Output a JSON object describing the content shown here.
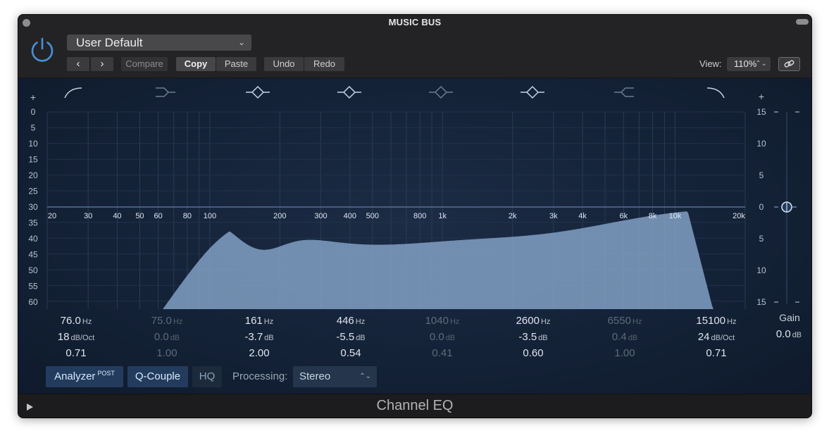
{
  "window": {
    "title": "MUSIC BUS",
    "plugin_name": "Channel EQ"
  },
  "header": {
    "preset": "User Default",
    "prev_label": "‹",
    "next_label": "›",
    "compare_label": "Compare",
    "copy_label": "Copy",
    "paste_label": "Paste",
    "undo_label": "Undo",
    "redo_label": "Redo",
    "view_label": "View:",
    "view_value": "110%"
  },
  "graph": {
    "db_left_labels": [
      "0",
      "5",
      "10",
      "15",
      "20",
      "25",
      "30",
      "35",
      "40",
      "45",
      "50",
      "55",
      "60"
    ],
    "db_right_labels": [
      "15",
      "10",
      "5",
      "0",
      "5",
      "10",
      "15"
    ],
    "freq_labels": [
      "20",
      "30",
      "40",
      "50",
      "60",
      "80",
      "100",
      "200",
      "300",
      "400",
      "500",
      "800",
      "1k",
      "2k",
      "3k",
      "4k",
      "6k",
      "8k",
      "10k",
      "20k"
    ]
  },
  "bands": [
    {
      "freq": "76.0",
      "freq_unit": "Hz",
      "gain": "18",
      "gain_unit": "dB/Oct",
      "q": "0.71",
      "active": true,
      "type": "low-cut"
    },
    {
      "freq": "75.0",
      "freq_unit": "Hz",
      "gain": "0.0",
      "gain_unit": "dB",
      "q": "1.00",
      "active": false,
      "type": "low-shelf"
    },
    {
      "freq": "161",
      "freq_unit": "Hz",
      "gain": "-3.7",
      "gain_unit": "dB",
      "q": "2.00",
      "active": true,
      "type": "bell"
    },
    {
      "freq": "446",
      "freq_unit": "Hz",
      "gain": "-5.5",
      "gain_unit": "dB",
      "q": "0.54",
      "active": true,
      "type": "bell"
    },
    {
      "freq": "1040",
      "freq_unit": "Hz",
      "gain": "0.0",
      "gain_unit": "dB",
      "q": "0.41",
      "active": false,
      "type": "bell"
    },
    {
      "freq": "2600",
      "freq_unit": "Hz",
      "gain": "-3.5",
      "gain_unit": "dB",
      "q": "0.60",
      "active": true,
      "type": "bell"
    },
    {
      "freq": "6550",
      "freq_unit": "Hz",
      "gain": "0.4",
      "gain_unit": "dB",
      "q": "1.00",
      "active": false,
      "type": "high-shelf"
    },
    {
      "freq": "15100",
      "freq_unit": "Hz",
      "gain": "24",
      "gain_unit": "dB/Oct",
      "q": "0.71",
      "active": true,
      "type": "high-cut"
    }
  ],
  "gain": {
    "label": "Gain",
    "value": "0.0",
    "unit": "dB"
  },
  "bottom": {
    "analyzer_label": "Analyzer",
    "analyzer_mode": "POST",
    "qcouple_label": "Q-Couple",
    "hq_label": "HQ",
    "processing_label": "Processing:",
    "processing_value": "Stereo"
  },
  "colors": {
    "accent": "#4a90d9",
    "curve_fill": "#8aaad0",
    "panel_bg": "#142238"
  }
}
